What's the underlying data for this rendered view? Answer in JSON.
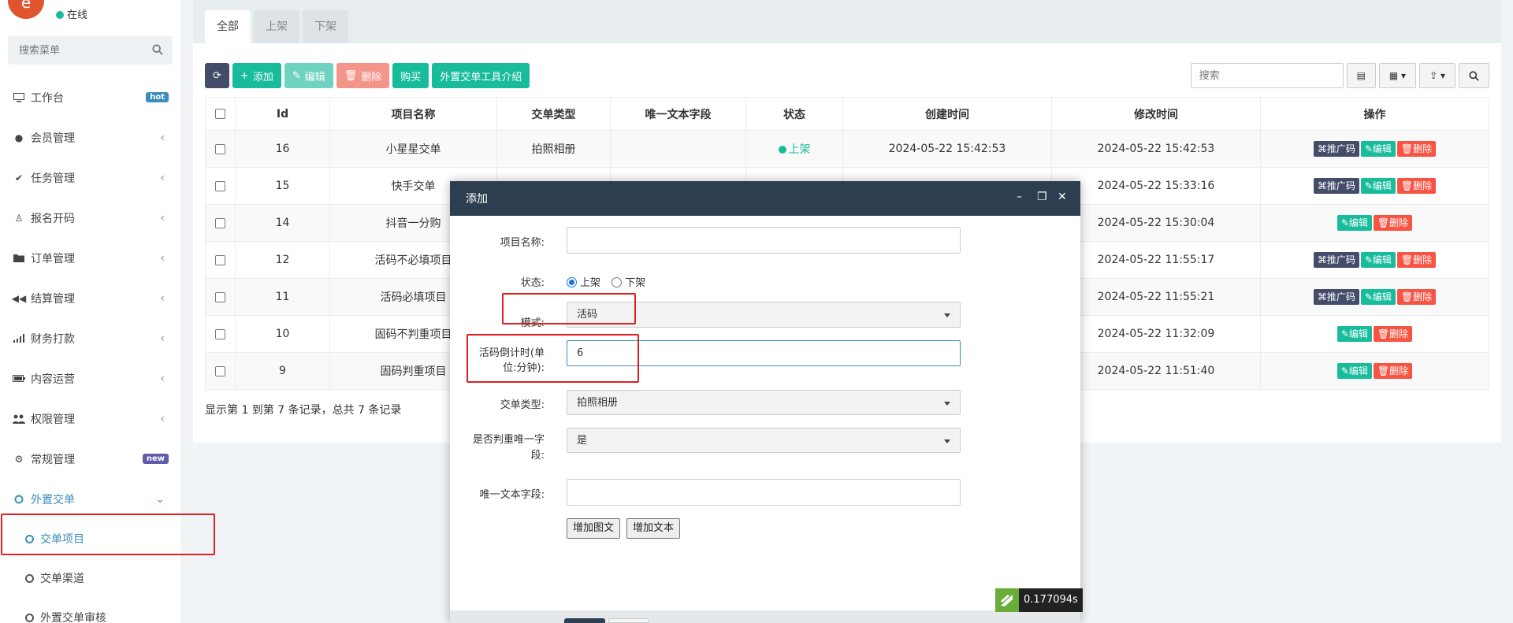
{
  "sidebar": {
    "avatar_text": "e",
    "status": "在线",
    "search_placeholder": "搜索菜单",
    "items": [
      {
        "label": "工作台",
        "badge": "hot"
      },
      {
        "label": "会员管理"
      },
      {
        "label": "任务管理"
      },
      {
        "label": "报名开码"
      },
      {
        "label": "订单管理"
      },
      {
        "label": "结算管理"
      },
      {
        "label": "财务打款"
      },
      {
        "label": "内容运营"
      },
      {
        "label": "权限管理"
      },
      {
        "label": "常规管理",
        "badge": "new"
      },
      {
        "label": "外置交单"
      }
    ],
    "sub_items": [
      {
        "label": "交单项目"
      },
      {
        "label": "交单渠道"
      },
      {
        "label": "外置交单审核"
      }
    ]
  },
  "tabs": [
    {
      "label": "全部"
    },
    {
      "label": "上架"
    },
    {
      "label": "下架"
    }
  ],
  "toolbar": {
    "add": "添加",
    "edit": "编辑",
    "delete": "删除",
    "buy": "购买",
    "intro": "外置交单工具介绍",
    "search_placeholder": "搜索"
  },
  "table": {
    "headers": [
      "Id",
      "项目名称",
      "交单类型",
      "唯一文本字段",
      "状态",
      "创建时间",
      "修改时间",
      "操作"
    ],
    "rows": [
      {
        "id": "16",
        "name": "小星星交单",
        "type": "拍照相册",
        "unique": "",
        "status": "上架",
        "created": "2024-05-22 15:42:53",
        "modified": "2024-05-22 15:42:53",
        "qr": true
      },
      {
        "id": "15",
        "name": "快手交单",
        "type": "",
        "unique": "",
        "status": "",
        "created": "",
        "modified": "2024-05-22 15:33:16",
        "qr": true
      },
      {
        "id": "14",
        "name": "抖音一分购",
        "type": "",
        "unique": "",
        "status": "",
        "created": "",
        "modified": "2024-05-22 15:30:04",
        "qr": false
      },
      {
        "id": "12",
        "name": "活码不必填项目",
        "type": "",
        "unique": "",
        "status": "",
        "created": "",
        "modified": "2024-05-22 11:55:17",
        "qr": true
      },
      {
        "id": "11",
        "name": "活码必填项目",
        "type": "",
        "unique": "",
        "status": "",
        "created": "",
        "modified": "2024-05-22 11:55:21",
        "qr": true
      },
      {
        "id": "10",
        "name": "固码不判重项目",
        "type": "",
        "unique": "",
        "status": "",
        "created": "",
        "modified": "2024-05-22 11:32:09",
        "qr": false
      },
      {
        "id": "9",
        "name": "固码判重项目",
        "type": "",
        "unique": "",
        "status": "",
        "created": "",
        "modified": "2024-05-22 11:51:40",
        "qr": false
      }
    ],
    "op_qr": "推广码",
    "op_edit": "编辑",
    "op_delete": "删除"
  },
  "pager": "显示第 1 到第 7 条记录，总共 7 条记录",
  "modal": {
    "title": "添加",
    "name_label": "项目名称:",
    "name_value": "",
    "status_label": "状态:",
    "status_on": "上架",
    "status_off": "下架",
    "status_selected": "上架",
    "mode_label": "模式:",
    "mode_value": "活码",
    "countdown_label_1": "活码倒计时(单",
    "countdown_label_2": "位:分钟):",
    "countdown_value": "6",
    "type_label": "交单类型:",
    "type_value": "拍照相册",
    "dedupe_label_1": "是否判重唯一字",
    "dedupe_label_2": "段:",
    "dedupe_value": "是",
    "unique_label": "唯一文本字段:",
    "unique_value": "",
    "add_image_text": "增加图文",
    "add_text": "增加文本"
  },
  "timing": "0.177094s",
  "colors": {
    "accent": "#3c8dbc",
    "green": "#18bc9c",
    "red": "#f75444",
    "dark": "#444c69",
    "modal_header": "#2c3e50",
    "highlight_box": "#e02020"
  }
}
